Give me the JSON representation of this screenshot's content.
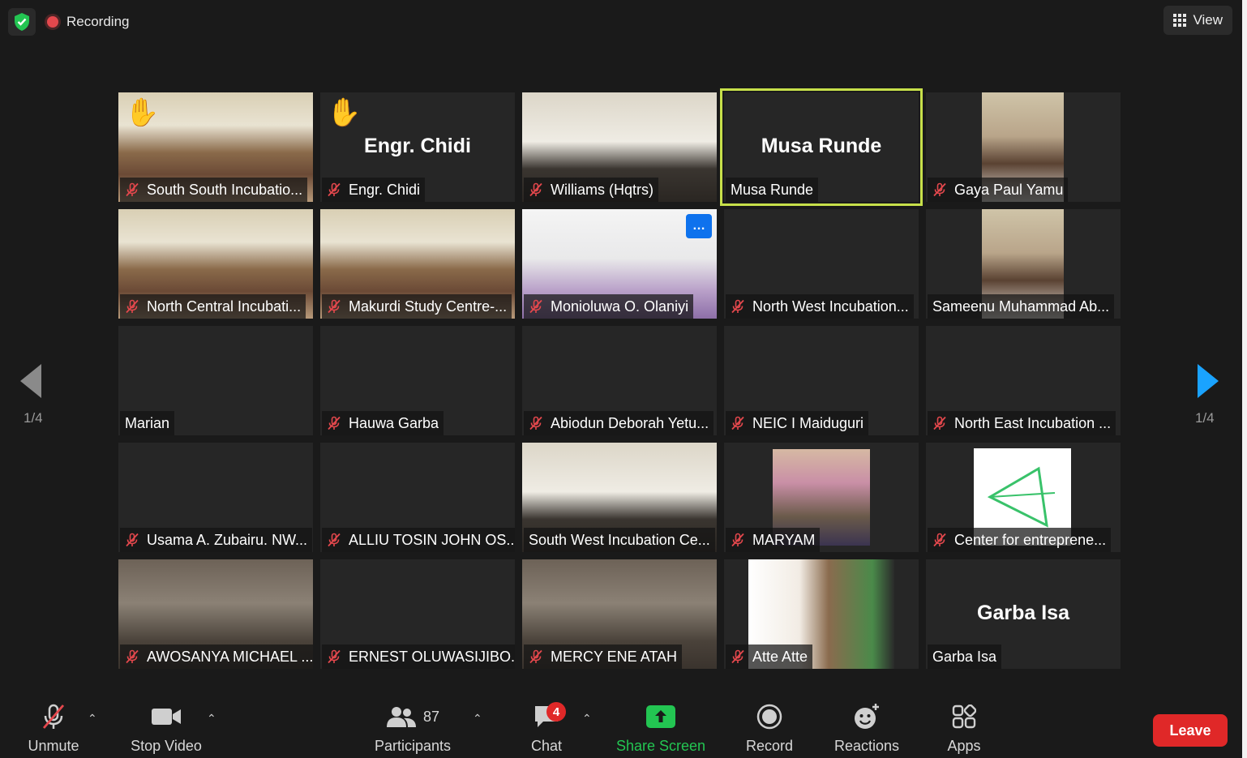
{
  "topbar": {
    "recording_label": "Recording",
    "view_label": "View"
  },
  "participants": [
    {
      "name": "South South Incubatio...",
      "muted": true,
      "hand": true,
      "video": "classroom"
    },
    {
      "name": "Engr. Chidi",
      "big": "Engr. Chidi",
      "muted": true,
      "hand": true
    },
    {
      "name": "Williams (Hqtrs)",
      "muted": true,
      "video": "office"
    },
    {
      "name": "Musa Runde",
      "big": "Musa Runde",
      "muted": false,
      "active": true
    },
    {
      "name": "Gaya Paul Yamu",
      "muted": true,
      "video": "portrait"
    },
    {
      "name": "North Central Incubati...",
      "muted": true,
      "video": "classroom"
    },
    {
      "name": "Makurdi Study Centre-...",
      "muted": true,
      "video": "classroom"
    },
    {
      "name": "Monioluwa O. Olaniyi",
      "muted": true,
      "video": "bright",
      "more": true
    },
    {
      "name": "North West Incubation...",
      "muted": true
    },
    {
      "name": "Sameenu Muhammad Ab...",
      "muted": false,
      "video": "portrait"
    },
    {
      "name": "Marian",
      "muted": false
    },
    {
      "name": "Hauwa Garba",
      "muted": true
    },
    {
      "name": "Abiodun Deborah Yetu...",
      "muted": true
    },
    {
      "name": "NEIC I Maiduguri",
      "muted": true
    },
    {
      "name": "North East Incubation ...",
      "muted": true
    },
    {
      "name": "Usama A. Zubairu. NW...",
      "muted": true
    },
    {
      "name": "ALLIU TOSIN JOHN OS...",
      "muted": true
    },
    {
      "name": "South West Incubation Ce...",
      "muted": false,
      "video": "office"
    },
    {
      "name": "MARYAM",
      "muted": true,
      "video": "portrait-pink"
    },
    {
      "name": "Center for entreprene...",
      "muted": true,
      "video": "logo"
    },
    {
      "name": "AWOSANYA MICHAEL ...",
      "muted": true,
      "video": "dim"
    },
    {
      "name": "ERNEST OLUWASIJIBO...",
      "muted": true
    },
    {
      "name": "MERCY ENE ATAH",
      "muted": true,
      "video": "dim"
    },
    {
      "name": "Atte Atte",
      "muted": true,
      "video": "portrait-wide"
    },
    {
      "name": "Garba Isa",
      "big": "Garba Isa",
      "muted": false
    }
  ],
  "pagination": {
    "left": "1/4",
    "right": "1/4"
  },
  "toolbar": {
    "unmute": "Unmute",
    "stop_video": "Stop Video",
    "participants": "Participants",
    "participant_count": "87",
    "chat": "Chat",
    "chat_badge": "4",
    "share_screen": "Share Screen",
    "record": "Record",
    "reactions": "Reactions",
    "apps": "Apps",
    "leave": "Leave"
  },
  "colors": {
    "active_speaker": "#c7e04a",
    "share_green": "#23c552",
    "leave_red": "#e02828",
    "nav_blue": "#1aa3ff",
    "muted_red": "#e5484d"
  }
}
